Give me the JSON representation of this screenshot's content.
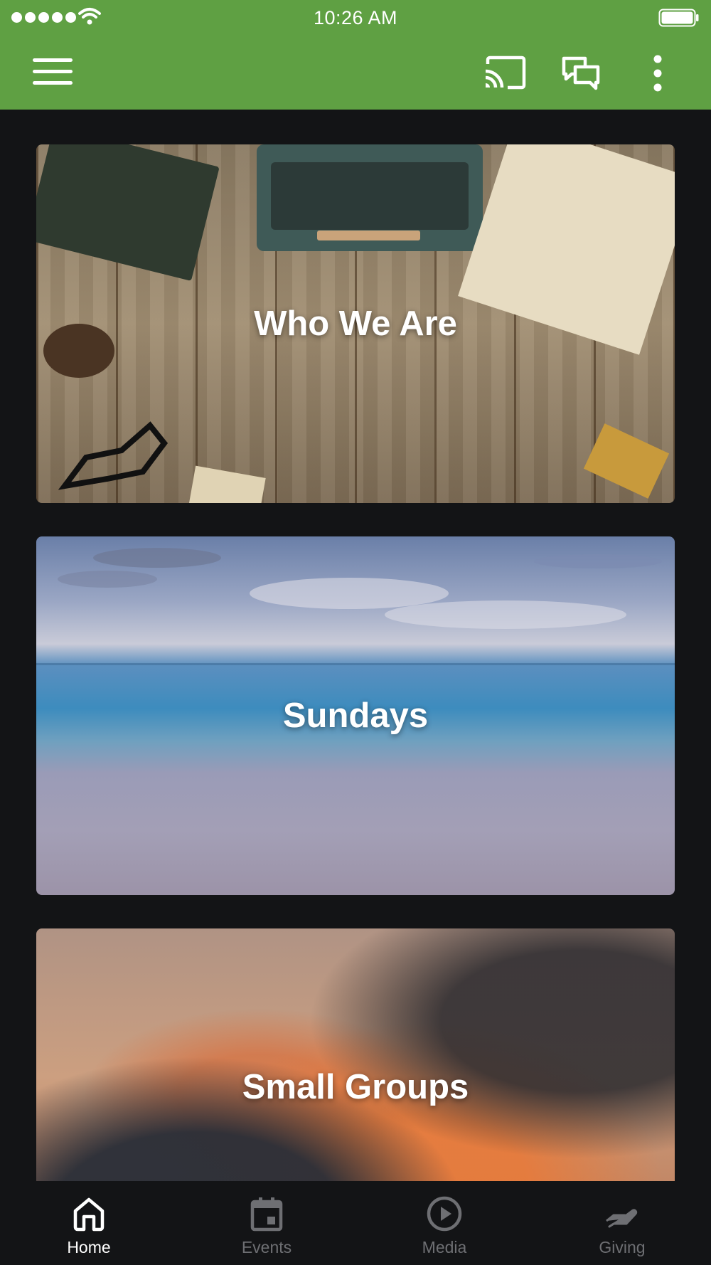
{
  "status_bar": {
    "time": "10:26 AM",
    "signal_icon": "signal-dots-icon",
    "wifi_icon": "wifi-icon",
    "battery_icon": "battery-icon"
  },
  "app_bar": {
    "color": "#5fa043",
    "menu_icon": "hamburger-menu-icon",
    "actions": [
      "cast-icon",
      "chat-bubbles-icon",
      "more-vertical-icon"
    ]
  },
  "cards": [
    {
      "title": "Who We Are"
    },
    {
      "title": "Sundays"
    },
    {
      "title": "Small Groups"
    }
  ],
  "tabs": [
    {
      "label": "Home",
      "icon": "home-icon",
      "active": true
    },
    {
      "label": "Events",
      "icon": "calendar-icon",
      "active": false
    },
    {
      "label": "Media",
      "icon": "play-circle-icon",
      "active": false
    },
    {
      "label": "Giving",
      "icon": "giving-hand-icon",
      "active": false
    }
  ]
}
